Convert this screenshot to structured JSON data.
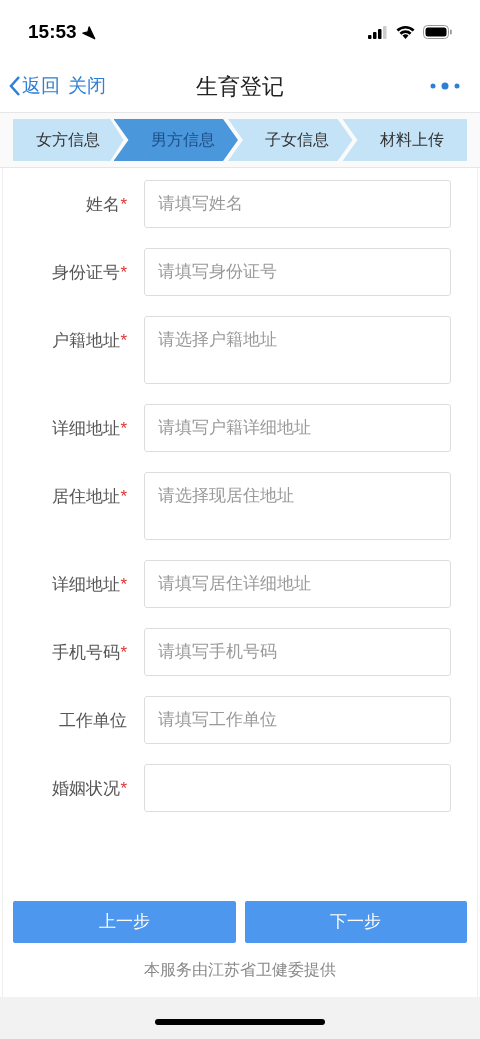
{
  "status_bar": {
    "time": "15:53"
  },
  "nav": {
    "back": "返回",
    "close": "关闭",
    "title": "生育登记"
  },
  "steps": [
    {
      "label": "女方信息",
      "selected": false
    },
    {
      "label": "男方信息",
      "selected": true
    },
    {
      "label": "子女信息",
      "selected": false
    },
    {
      "label": "材料上传",
      "selected": false
    }
  ],
  "fields": [
    {
      "label": "姓名",
      "required_mark": "*",
      "kind": "single",
      "placeholder": "请填写姓名"
    },
    {
      "label": "身份证号",
      "required_mark": "*",
      "kind": "single",
      "placeholder": "请填写身份证号"
    },
    {
      "label": "户籍地址",
      "required_mark": "*",
      "kind": "multi",
      "placeholder": "请选择户籍地址"
    },
    {
      "label": "详细地址",
      "required_mark": "*",
      "kind": "single",
      "placeholder": "请填写户籍详细地址"
    },
    {
      "label": "居住地址",
      "required_mark": "*",
      "kind": "multi",
      "placeholder": "请选择现居住地址"
    },
    {
      "label": "详细地址",
      "required_mark": "*",
      "kind": "single",
      "placeholder": "请填写居住详细地址"
    },
    {
      "label": "手机号码",
      "required_mark": "*",
      "kind": "single",
      "placeholder": "请填写手机号码"
    },
    {
      "label": "工作单位",
      "kind": "single",
      "placeholder": "请填写工作单位"
    },
    {
      "label": "婚姻状况",
      "required_mark": "*",
      "kind": "single"
    }
  ],
  "buttons": [
    "上一步",
    "下一步"
  ],
  "footer": "本服务由江苏省卫健委提供"
}
